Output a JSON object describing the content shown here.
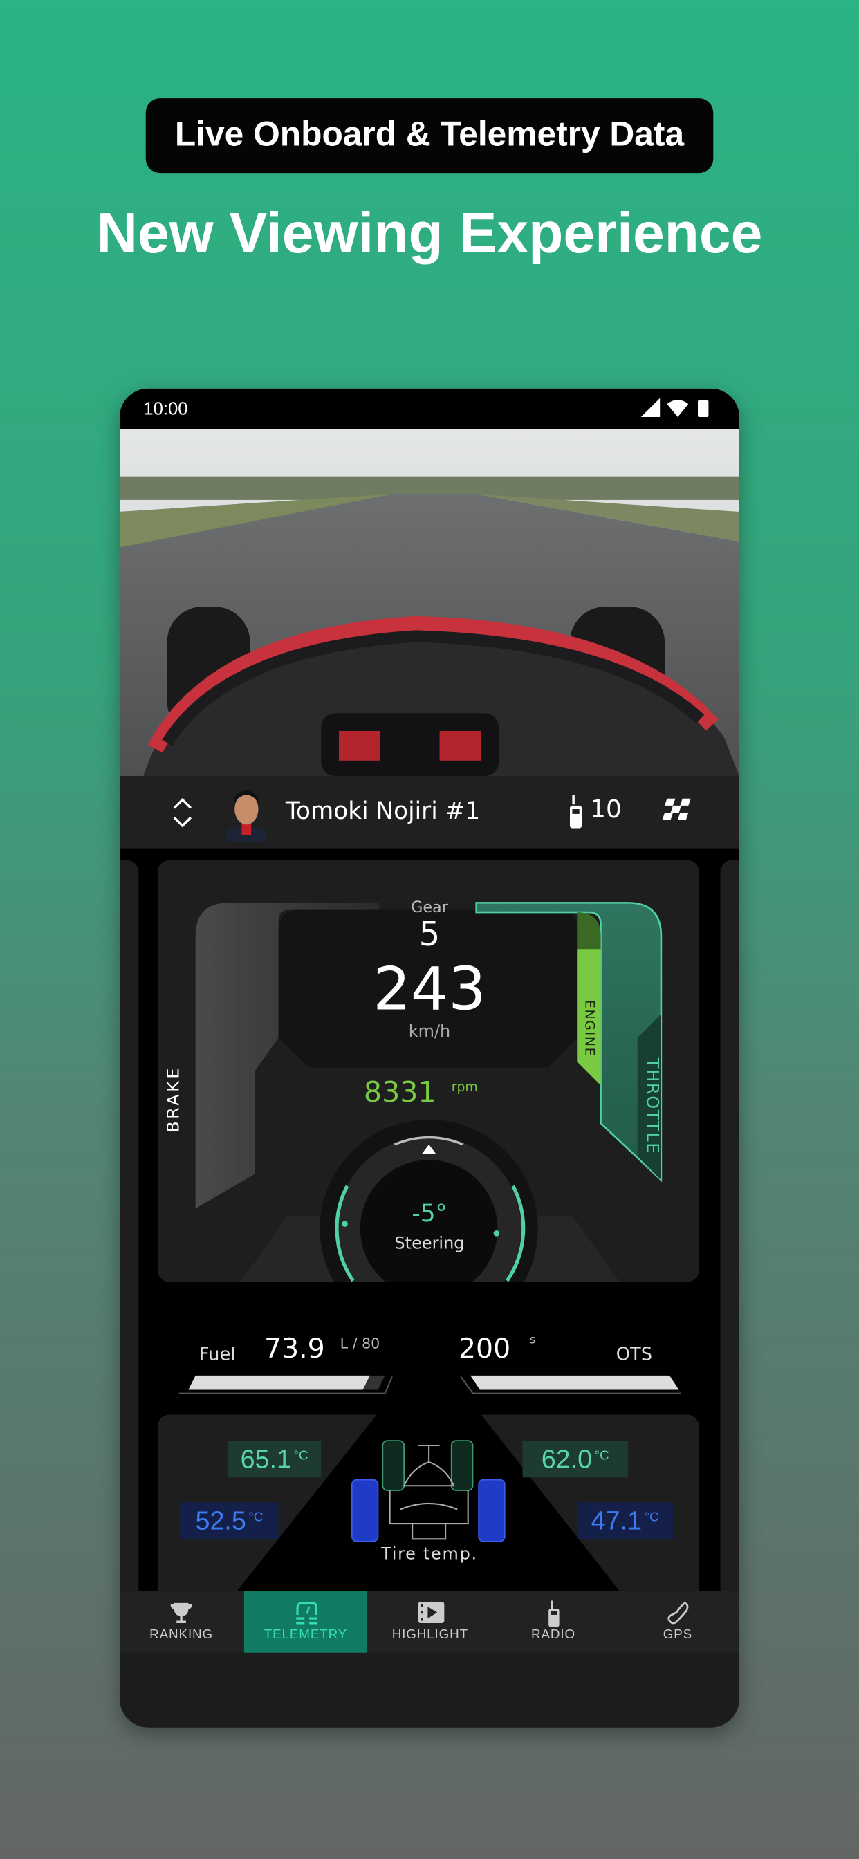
{
  "promo": {
    "badge": "Live Onboard & Telemetry Data",
    "headline": "New Viewing Experience"
  },
  "status_bar": {
    "time": "10:00",
    "icons": [
      "signal-icon",
      "wifi-icon",
      "battery-icon"
    ]
  },
  "driver_bar": {
    "name": "Tomoki Nojiri #1",
    "radio_count": "10",
    "icons": [
      "switch-driver-icon",
      "radio-icon",
      "checkered-flag-icon"
    ]
  },
  "telemetry": {
    "gear_label": "Gear",
    "gear": "5",
    "speed": "243",
    "speed_unit": "km/h",
    "rpm": "8331",
    "rpm_unit": "rpm",
    "brake_label": "BRAKE",
    "engine_label": "ENGINE",
    "throttle_label": "THROTTLE",
    "brake_level": 0,
    "throttle_level": 100,
    "steering": "-5°",
    "steering_label": "Steering",
    "fuel_label": "Fuel",
    "fuel": "73.9",
    "fuel_unit": "L / 80",
    "fuel_fraction": 0.92,
    "ots": "200",
    "ots_unit": "s",
    "ots_label": "OTS",
    "ots_fraction": 1.0,
    "tires": {
      "front_left": "65.1",
      "front_right": "62.0",
      "rear_left": "52.5",
      "rear_right": "47.1",
      "unit": "°C",
      "label": "Tire temp."
    }
  },
  "colors": {
    "accent": "#117a62",
    "throttle": "#4fd1a5",
    "engine": "#7ac943",
    "rear_tire": "#3d7cf0"
  },
  "nav": {
    "items": [
      {
        "label": "RANKING",
        "icon": "trophy-icon"
      },
      {
        "label": "TELEMETRY",
        "icon": "gauge-icon",
        "active": true
      },
      {
        "label": "HIGHLIGHT",
        "icon": "video-icon"
      },
      {
        "label": "RADIO",
        "icon": "radio-icon"
      },
      {
        "label": "GPS",
        "icon": "track-map-icon"
      }
    ]
  }
}
